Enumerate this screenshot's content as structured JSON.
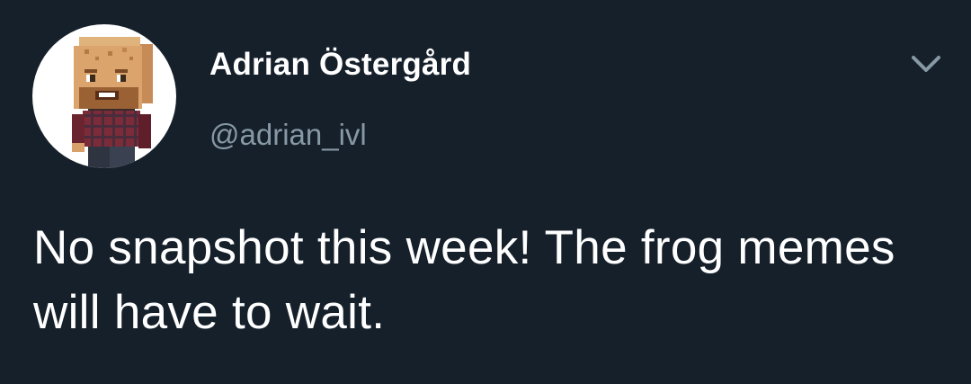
{
  "tweet": {
    "author": {
      "display_name": "Adrian Östergård",
      "handle": "@adrian_ivl",
      "avatar_icon": "minecraft-style-blocky-character-avatar"
    },
    "menu_icon": "chevron-down-icon",
    "text": "No snapshot this week! The frog memes will have to wait."
  },
  "colors": {
    "background": "#15202b",
    "primary_text": "#ffffff",
    "secondary_text": "#8899a6",
    "chevron": "#8899a6"
  }
}
